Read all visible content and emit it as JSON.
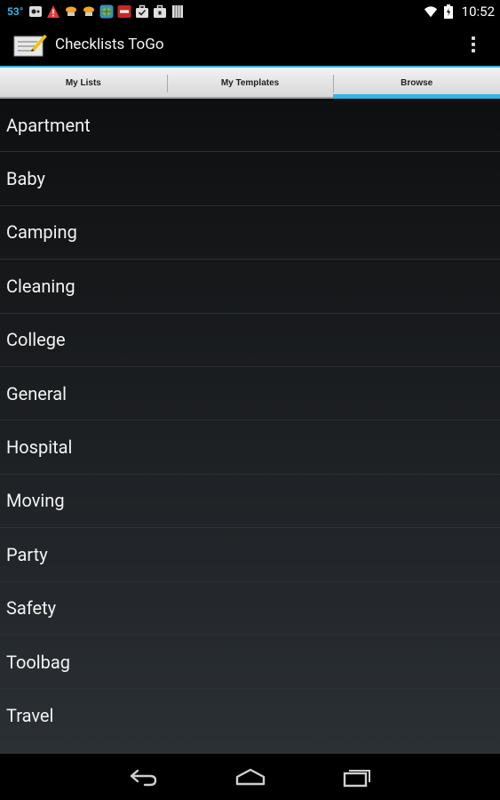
{
  "status_bar": {
    "temperature": "53°",
    "time": "10:52",
    "icons": [
      "weather-icon",
      "game-controller-icon",
      "warning-icon",
      "worker-icon",
      "worker-icon",
      "globe-icon",
      "news-icon",
      "briefcase-icon",
      "briefcase-icon",
      "notes-icon",
      "wifi-icon",
      "battery-icon"
    ]
  },
  "action_bar": {
    "title": "Checklists ToGo",
    "app_icon": "checklist-app-icon",
    "overflow_icon": "overflow-menu-icon"
  },
  "tabs": [
    {
      "label": "My Lists",
      "selected": false
    },
    {
      "label": "My Templates",
      "selected": false
    },
    {
      "label": "Browse",
      "selected": true
    }
  ],
  "categories": [
    "Apartment",
    "Baby",
    "Camping",
    "Cleaning",
    "College",
    "General",
    "Hospital",
    "Moving",
    "Party",
    "Safety",
    "Toolbag",
    "Travel"
  ],
  "navigation": [
    "back-icon",
    "home-icon",
    "recent-apps-icon"
  ],
  "colors": {
    "accent": "#33b5e5",
    "background": "#000000"
  }
}
